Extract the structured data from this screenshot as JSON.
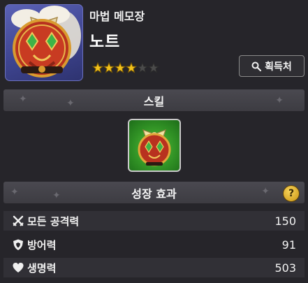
{
  "item": {
    "category": "마법 메모장",
    "name": "노트",
    "rating": {
      "filled": 4,
      "total": 6
    },
    "acquire_label": "획득처"
  },
  "sections": {
    "skill_title": "스킬",
    "growth_title": "성장 효과",
    "help_symbol": "?"
  },
  "stats": [
    {
      "label": "모든 공격력",
      "value": "150",
      "icon": "crossed-swords-icon"
    },
    {
      "label": "방어력",
      "value": "91",
      "icon": "shield-icon"
    },
    {
      "label": "생명력",
      "value": "503",
      "icon": "heart-icon"
    }
  ],
  "colors": {
    "background": "#26252a",
    "section_bar": "#424147",
    "star_filled": "#f3c21b",
    "star_empty": "#4b4b4b",
    "skill_bg": "#3aa62c"
  }
}
